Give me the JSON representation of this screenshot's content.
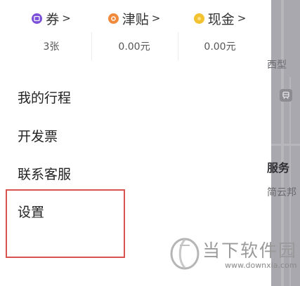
{
  "wallet": [
    {
      "label": "券",
      "value": "3张",
      "icon": "ticket-coupon-icon",
      "color": "#7b4fd8"
    },
    {
      "label": "津贴",
      "value": "0.00元",
      "icon": "allowance-coin-icon",
      "color": "#f08a3c"
    },
    {
      "label": "现金",
      "value": "0.00元",
      "icon": "cash-coin-icon",
      "color": "#f2c230"
    }
  ],
  "chevron": ">",
  "menu": {
    "trips": "我的行程",
    "invoice": "开发票",
    "support": "联系客服",
    "settings": "设置"
  },
  "map": {
    "label_type": "西型",
    "label_service": "服务",
    "label_place": "简云邦"
  },
  "watermark": {
    "title": "当下软件园",
    "url": "www.downxia.com"
  },
  "colors": {
    "highlight_border": "#d9534f",
    "map_overlay": "#a8a8ae"
  }
}
